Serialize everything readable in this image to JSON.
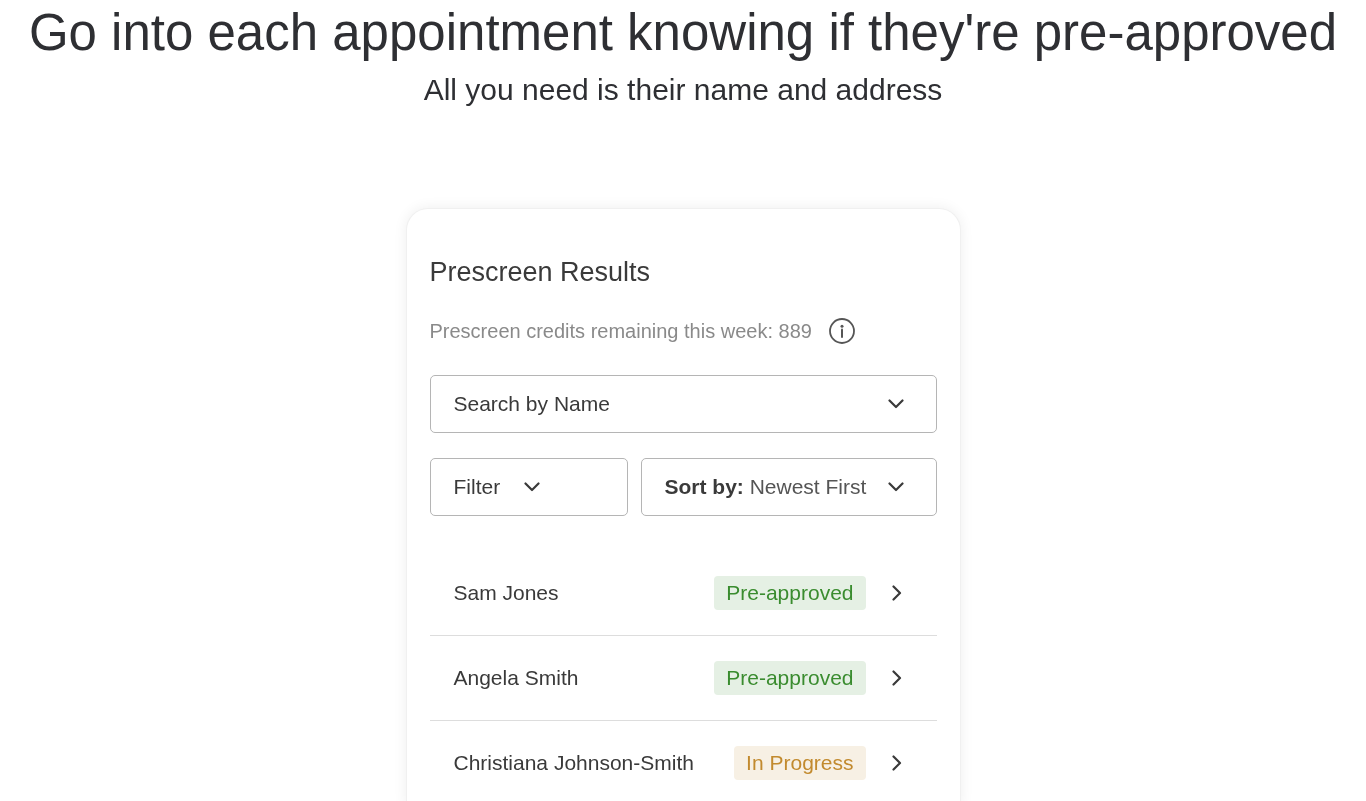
{
  "headline": "Go into each appointment knowing if they're pre-approved",
  "subheadline": "All you need is their name and address",
  "card": {
    "title": "Prescreen Results",
    "credits_text": "Prescreen credits remaining this week: 889",
    "search_dropdown": {
      "label": "Search by Name"
    },
    "filter_dropdown": {
      "label": "Filter"
    },
    "sort_dropdown": {
      "label": "**Sort by:** Newest First"
    },
    "results": [
      {
        "name": "Sam Jones",
        "status": "Pre-approved",
        "color": "#3a8c2f"
      },
      {
        "name": "Angela Smith",
        "status": "Pre-approved",
        "color": "#3a8c2f"
      },
      {
        "name": "Christiana Johnson-Smith",
        "status": "In Progress",
        "color": "#c28a2e"
      }
    ]
  }
}
